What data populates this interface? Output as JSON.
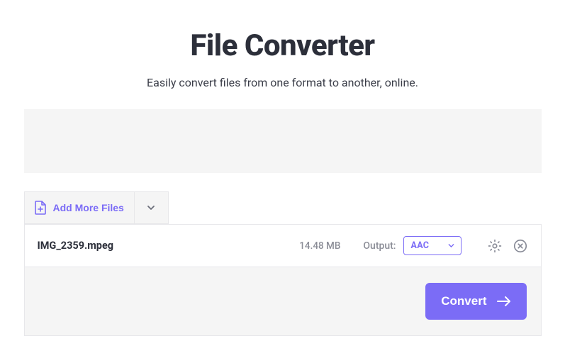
{
  "header": {
    "title": "File Converter",
    "subtitle": "Easily convert files from one format to another, online."
  },
  "actions": {
    "add_more_label": "Add More Files",
    "convert_label": "Convert"
  },
  "file": {
    "name": "IMG_2359.mpeg",
    "size": "14.48 MB",
    "output_label": "Output:",
    "output_value": "AAC"
  },
  "colors": {
    "accent": "#7b6cf6"
  }
}
